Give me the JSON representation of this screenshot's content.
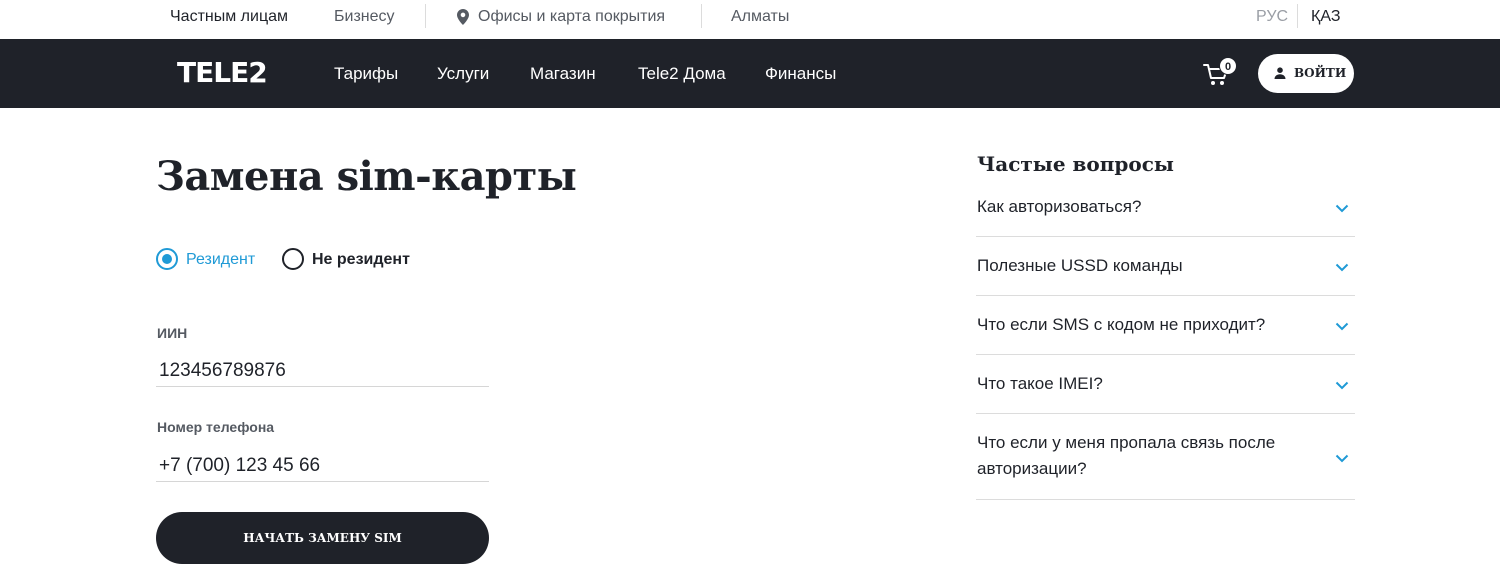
{
  "topbar": {
    "segments": [
      "Частным лицам",
      "Бизнесу"
    ],
    "offices": "Офисы и карта покрытия",
    "city": "Алматы",
    "lang_ru": "РУС",
    "lang_kz": "ҚАЗ"
  },
  "nav": {
    "logo": "TELE2",
    "links": [
      "Тарифы",
      "Услуги",
      "Магазин",
      "Tele2 Дома",
      "Финансы"
    ],
    "cart_count": "0",
    "login": "ВОЙТИ"
  },
  "page": {
    "title": "Замена sim-карты",
    "radio_resident": "Резидент",
    "radio_nonresident": "Не резидент",
    "iin_label": "ИИН",
    "iin_value": "123456789876",
    "phone_label": "Номер телефона",
    "phone_value": "+7 (700) 123 45 66",
    "submit": "НАЧАТЬ ЗАМЕНУ SIM"
  },
  "faq": {
    "title": "Частые вопросы",
    "items": [
      "Как авторизоваться?",
      "Полезные USSD команды",
      "Что если SMS с кодом не приходит?",
      "Что такое IMEI?",
      "Что если у меня пропала связь после авторизации?"
    ]
  },
  "colors": {
    "accent": "#1f9ad6",
    "dark": "#1f2229"
  }
}
